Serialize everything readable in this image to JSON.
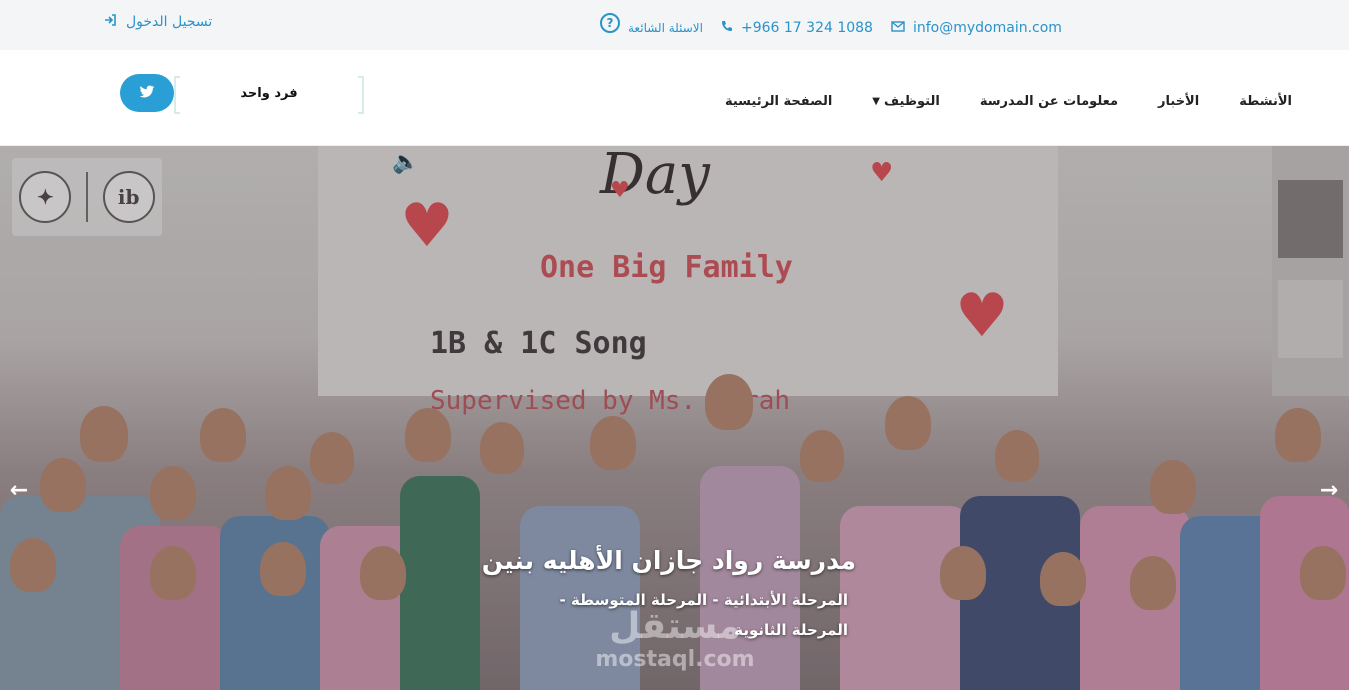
{
  "topbar": {
    "login_label": "تسجيل الدخول",
    "faq_label": "الاسئلة الشائعة",
    "phone": "+966 17 324 1088",
    "email": "info@mydomain.com"
  },
  "navbar": {
    "logo_text": "فرد واحد",
    "menu": [
      {
        "label": "الصفحة الرئيسية"
      },
      {
        "label": "التوظيف",
        "has_dropdown": true
      },
      {
        "label": "معلومات عن المدرسة"
      },
      {
        "label": "الأخبار"
      },
      {
        "label": "الأنشطة"
      }
    ]
  },
  "hero": {
    "board_day": "Day",
    "board_family": "One Big Family",
    "board_song": "1B & 1C Song",
    "board_supervised": "Supervised by Ms. Sarah",
    "logo_right": "ib",
    "title": "مدرسة رواد جازان الأهليه بنين",
    "subtitle": "المرحلة الأبتدائية - المرحلة المتوسطة - المرحلة الثانوية",
    "prev_arrow": "←",
    "next_arrow": "→"
  },
  "watermark": {
    "arabic": "مستقل",
    "latin": "mostaql.com"
  },
  "colors": {
    "accent": "#2a93c9",
    "twitter": "#2a9fd6",
    "topbar_bg": "#f4f5f7",
    "heart": "#e0565f"
  },
  "icons": [
    "login-icon",
    "help-circle-icon",
    "phone-icon",
    "envelope-icon",
    "twitter-icon",
    "caret-down-icon",
    "speaker-icon",
    "arrow-left-icon",
    "arrow-right-icon"
  ]
}
